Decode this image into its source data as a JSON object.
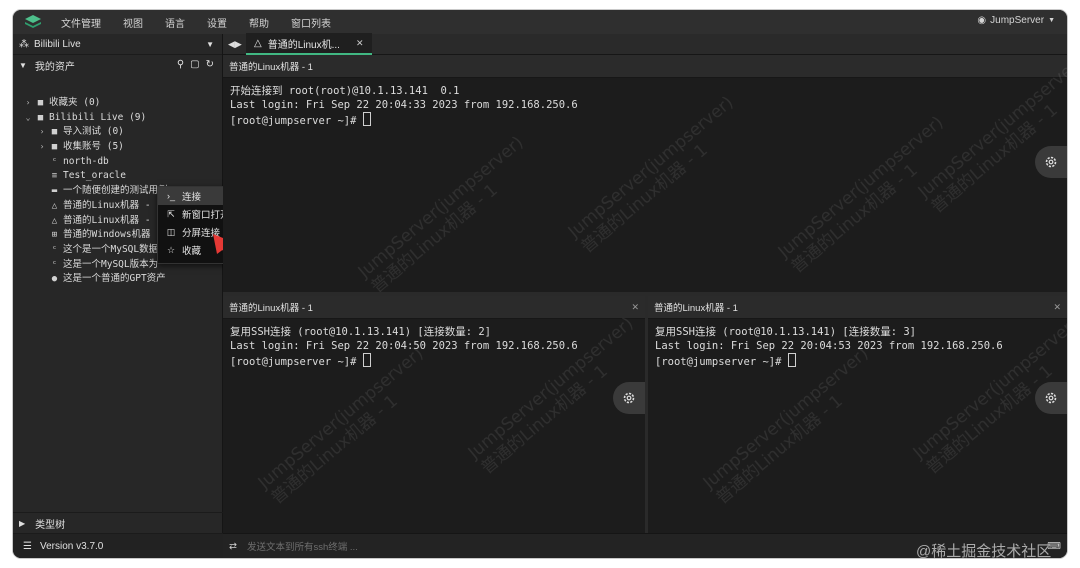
{
  "menubar": {
    "items": [
      "文件管理",
      "视图",
      "语言",
      "设置",
      "帮助",
      "窗口列表"
    ],
    "user": "JumpServer"
  },
  "sidebar": {
    "org": "Bilibili Live",
    "assets_title": "我的资产",
    "tree": [
      {
        "toggle": "›",
        "icon": "folder-icon",
        "glyph": "■",
        "label": "收藏夹 (0)",
        "indent": 0
      },
      {
        "toggle": "⌄",
        "icon": "folder-icon",
        "glyph": "■",
        "label": "Bilibili Live (9)",
        "indent": 0
      },
      {
        "toggle": "›",
        "icon": "folder-icon",
        "glyph": "■",
        "label": "导入测试 (0)",
        "indent": 1
      },
      {
        "toggle": "›",
        "icon": "folder-icon",
        "glyph": "■",
        "label": "收集账号 (5)",
        "indent": 1
      },
      {
        "toggle": "",
        "icon": "postgres-icon",
        "glyph": "ᶜ",
        "label": "north-db",
        "indent": 1
      },
      {
        "toggle": "",
        "icon": "database-icon",
        "glyph": "≡",
        "label": "Test_oracle",
        "indent": 1
      },
      {
        "toggle": "",
        "icon": "server-icon",
        "glyph": "▬",
        "label": "一个随便创建的测试用例",
        "indent": 1
      },
      {
        "toggle": "",
        "icon": "linux-icon",
        "glyph": "△",
        "label": "普通的Linux机器 -",
        "indent": 1
      },
      {
        "toggle": "",
        "icon": "linux-icon",
        "glyph": "△",
        "label": "普通的Linux机器 -",
        "indent": 1
      },
      {
        "toggle": "",
        "icon": "windows-icon",
        "glyph": "⊞",
        "label": "普通的Windows机器",
        "indent": 1
      },
      {
        "toggle": "",
        "icon": "mysql-icon",
        "glyph": "ᶜ",
        "label": "这个是一个MySQL数据",
        "indent": 1
      },
      {
        "toggle": "",
        "icon": "mysql-icon",
        "glyph": "ᶜ",
        "label": "这是一个MySQL版本为",
        "indent": 1
      },
      {
        "toggle": "",
        "icon": "gpt-icon",
        "glyph": "●",
        "label": "这是一个普通的GPT资产",
        "indent": 1
      }
    ],
    "type_tree": "类型树",
    "version": "Version v3.7.0"
  },
  "context_menu": {
    "items": [
      {
        "icon": "terminal-icon",
        "glyph": "›_",
        "label": "连接"
      },
      {
        "icon": "external-link-icon",
        "glyph": "⇱",
        "label": "新窗口打开"
      },
      {
        "icon": "split-icon",
        "glyph": "◫",
        "label": "分屏连接"
      },
      {
        "icon": "star-icon",
        "glyph": "☆",
        "label": "收藏"
      }
    ]
  },
  "tabs": [
    {
      "label": "普通的Linux机..."
    }
  ],
  "panes": {
    "top": {
      "title": "普通的Linux机器 - 1",
      "lines": [
        "开始连接到 root(root)@10.1.13.141  0.1",
        "Last login: Fri Sep 22 20:04:33 2023 from 192.168.250.6",
        "[root@jumpserver ~]# "
      ]
    },
    "bottom_left": {
      "title": "普通的Linux机器 - 1",
      "lines": [
        "复用SSH连接 (root@10.1.13.141) [连接数量: 2]",
        "Last login: Fri Sep 22 20:04:50 2023 from 192.168.250.6",
        "[root@jumpserver ~]# "
      ]
    },
    "bottom_right": {
      "title": "普通的Linux机器 - 1",
      "lines": [
        "复用SSH连接 (root@10.1.13.141) [连接数量: 3]",
        "Last login: Fri Sep 22 20:04:53 2023 from 192.168.250.6",
        "[root@jumpserver ~]# "
      ]
    }
  },
  "watermark": {
    "line1": "JumpServer(jumpserver)",
    "line2": "普通的Linux机器 - 1"
  },
  "footer": {
    "placeholder": "发送文本到所有ssh终端 ..."
  },
  "credit": "@稀土掘金技术社区",
  "colors": {
    "accent": "#41b883",
    "arrow": "#e53935",
    "background": "#1e1e1e"
  }
}
